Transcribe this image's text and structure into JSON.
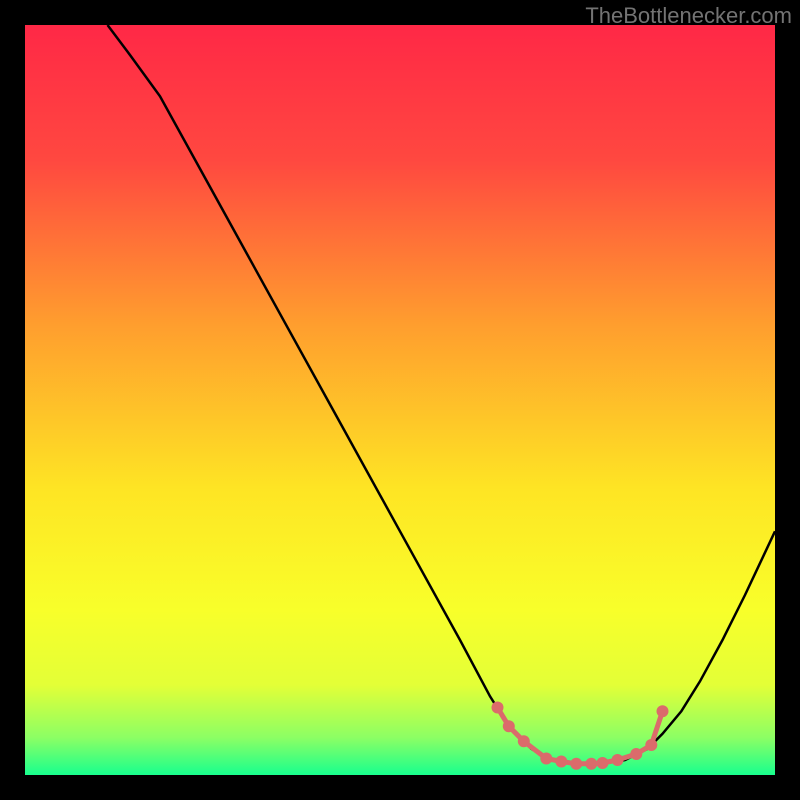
{
  "watermark": "TheBottlenecker.com",
  "chart_data": {
    "type": "line",
    "title": "",
    "xlabel": "",
    "ylabel": "",
    "xlim": [
      0,
      100
    ],
    "ylim": [
      0,
      100
    ],
    "gradient_stops": [
      {
        "offset": 0.0,
        "color": "#ff2846"
      },
      {
        "offset": 0.18,
        "color": "#ff4840"
      },
      {
        "offset": 0.4,
        "color": "#ff9e2e"
      },
      {
        "offset": 0.62,
        "color": "#fee524"
      },
      {
        "offset": 0.78,
        "color": "#f8ff2a"
      },
      {
        "offset": 0.88,
        "color": "#e3ff37"
      },
      {
        "offset": 0.95,
        "color": "#8cff64"
      },
      {
        "offset": 1.0,
        "color": "#18ff8e"
      }
    ],
    "curve": [
      {
        "x": 11.0,
        "y": 100.0
      },
      {
        "x": 14.0,
        "y": 96.0
      },
      {
        "x": 18.0,
        "y": 90.5
      },
      {
        "x": 26.0,
        "y": 76.0
      },
      {
        "x": 34.0,
        "y": 61.5
      },
      {
        "x": 42.0,
        "y": 47.0
      },
      {
        "x": 50.0,
        "y": 32.5
      },
      {
        "x": 58.0,
        "y": 18.0
      },
      {
        "x": 62.0,
        "y": 10.5
      },
      {
        "x": 64.5,
        "y": 6.5
      },
      {
        "x": 67.5,
        "y": 3.5
      },
      {
        "x": 70.0,
        "y": 2.0
      },
      {
        "x": 73.5,
        "y": 1.5
      },
      {
        "x": 77.0,
        "y": 1.5
      },
      {
        "x": 80.0,
        "y": 2.0
      },
      {
        "x": 83.0,
        "y": 3.5
      },
      {
        "x": 85.0,
        "y": 5.5
      },
      {
        "x": 87.5,
        "y": 8.5
      },
      {
        "x": 90.0,
        "y": 12.5
      },
      {
        "x": 93.0,
        "y": 18.0
      },
      {
        "x": 96.0,
        "y": 24.0
      },
      {
        "x": 100.0,
        "y": 32.5
      }
    ],
    "markers": [
      {
        "x": 63.0,
        "y": 9.0
      },
      {
        "x": 64.5,
        "y": 6.5
      },
      {
        "x": 66.5,
        "y": 4.5
      },
      {
        "x": 69.5,
        "y": 2.2
      },
      {
        "x": 71.5,
        "y": 1.8
      },
      {
        "x": 73.5,
        "y": 1.5
      },
      {
        "x": 75.5,
        "y": 1.5
      },
      {
        "x": 77.0,
        "y": 1.6
      },
      {
        "x": 79.0,
        "y": 2.0
      },
      {
        "x": 81.5,
        "y": 2.8
      },
      {
        "x": 83.5,
        "y": 4.0
      },
      {
        "x": 85.0,
        "y": 8.5
      }
    ],
    "marker_color": "#db6b6b",
    "curve_color": "#000000"
  }
}
